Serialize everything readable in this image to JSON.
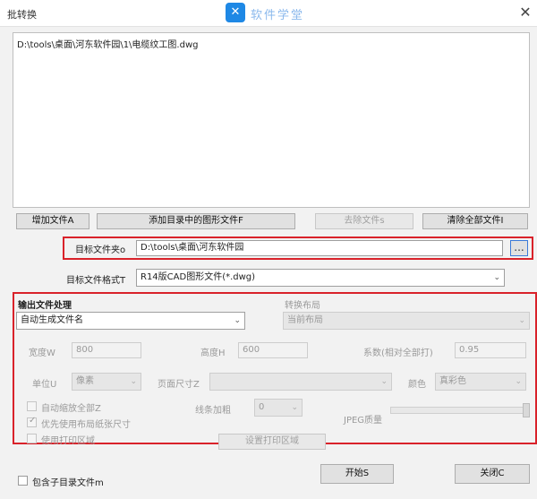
{
  "window": {
    "title": "批转换",
    "close_label": "✕"
  },
  "watermark": {
    "logo_glyph": "✕",
    "text": "软件学堂"
  },
  "file_list": {
    "items": [
      "D:\\tools\\桌面\\河东软件园\\1\\电缆纹工图.dwg"
    ]
  },
  "buttons": {
    "add_file": "增加文件A",
    "add_folder": "添加目录中的图形文件F",
    "remove_file": "去除文件s",
    "clear_all": "清除全部文件I",
    "start": "开始S",
    "close": "关闭C",
    "browse": "...",
    "plot_settings": "设置打印区域"
  },
  "target_folder": {
    "label": "目标文件夹o",
    "value": "D:\\tools\\桌面\\河东软件园"
  },
  "target_format": {
    "label": "目标文件格式T",
    "value": "R14版CAD图形文件(*.dwg)"
  },
  "naming": {
    "section_label": "输出文件处理",
    "value": "自动生成文件名"
  },
  "layout": {
    "section_label": "转换布局",
    "value": "当前布局"
  },
  "width": {
    "label": "宽度W",
    "value": "800"
  },
  "height": {
    "label": "高度H",
    "value": "600"
  },
  "factor": {
    "label": "系数(相对全部打)",
    "value": "0.95"
  },
  "unit": {
    "label": "单位U",
    "value": "像素"
  },
  "paper_size": {
    "label": "页面尺寸Z",
    "value": ""
  },
  "color": {
    "label": "颜色",
    "value": "真彩色"
  },
  "options": {
    "auto_zoom": "自动缩放全部Z",
    "use_layout_paper": "优先使用布局纸张尺寸",
    "use_plot_area": "使用打印区域"
  },
  "line_width": {
    "label": "线条加粗",
    "value": "0"
  },
  "jpeg_quality": {
    "label": "JPEG质量",
    "level_fraction": 1.0
  },
  "include_sub": {
    "label": "包含子目录文件m"
  },
  "colors": {
    "highlight_red": "#d9222a",
    "accent_blue": "#1e88e5"
  }
}
